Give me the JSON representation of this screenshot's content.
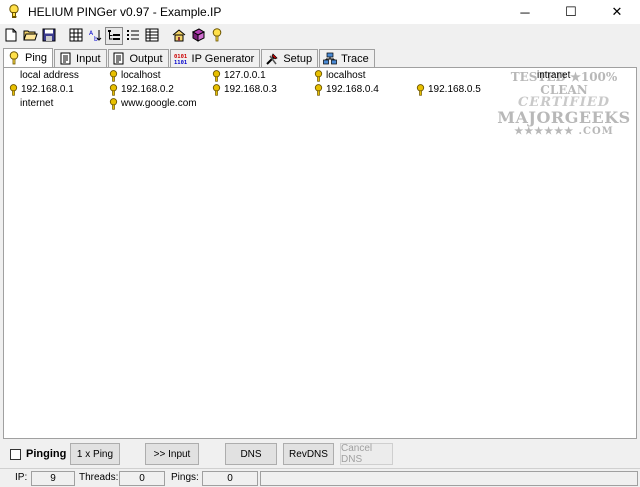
{
  "window": {
    "title": "HELIUM PINGer  v0.97  -  Example.IP",
    "minimize": "─",
    "maximize": "☐",
    "close": "✕"
  },
  "toolbar": {
    "buttons": [
      "new-icon",
      "open-icon",
      "save-icon",
      "grid-view-icon",
      "sort-icon",
      "tree-view-icon",
      "list-view-icon",
      "table-view-icon",
      "home-icon",
      "book-icon",
      "help-icon"
    ]
  },
  "tabs": [
    {
      "label": "Ping",
      "icon": "ping-key-icon",
      "active": true
    },
    {
      "label": "Input",
      "icon": "input-doc-icon",
      "active": false
    },
    {
      "label": "Output",
      "icon": "output-doc-icon",
      "active": false
    },
    {
      "label": "IP Generator",
      "icon": "binary-icon",
      "active": false
    },
    {
      "label": "Setup",
      "icon": "tools-icon",
      "active": false
    },
    {
      "label": "Trace",
      "icon": "network-icon",
      "active": false
    }
  ],
  "grid": {
    "rows": [
      [
        {
          "text": "local address",
          "key": false
        },
        {
          "text": "localhost",
          "key": true
        },
        {
          "text": "127.0.0.1",
          "key": true
        },
        {
          "text": "localhost",
          "key": true
        },
        {
          "text": "",
          "key": false
        },
        {
          "text": "intranet",
          "key": false
        }
      ],
      [
        {
          "text": "192.168.0.1",
          "key": true
        },
        {
          "text": "192.168.0.2",
          "key": true
        },
        {
          "text": "192.168.0.3",
          "key": true
        },
        {
          "text": "192.168.0.4",
          "key": true
        },
        {
          "text": "192.168.0.5",
          "key": true
        },
        {
          "text": "",
          "key": false
        }
      ],
      [
        {
          "text": "internet",
          "key": false
        },
        {
          "text": "www.google.com",
          "key": true
        },
        {
          "text": "",
          "key": false
        },
        {
          "text": "",
          "key": false
        },
        {
          "text": "",
          "key": false
        },
        {
          "text": "",
          "key": false
        }
      ]
    ]
  },
  "watermark": {
    "line1": "TESTED ★100% CLEAN",
    "line2": "CERTIFIED",
    "line3": "MAJORGEEKS",
    "line4": "★★★★★★ .COM"
  },
  "buttons": {
    "pinging_label": "Pinging",
    "pinging_checked": false,
    "ping_once": "1 x Ping",
    "to_input": ">> Input",
    "dns": "DNS",
    "rev_dns": "RevDNS",
    "cancel_dns": "Cancel DNS"
  },
  "status": {
    "ip_label": "IP:",
    "ip_value": "9",
    "threads_label": "Threads:",
    "threads_value": "0",
    "pings_label": "Pings:",
    "pings_value": "0"
  },
  "colors": {
    "key_yellow": "#e8c000",
    "key_outline": "#6b5400",
    "window_bg": "#f0f0f0",
    "list_bg": "#ffffff"
  }
}
